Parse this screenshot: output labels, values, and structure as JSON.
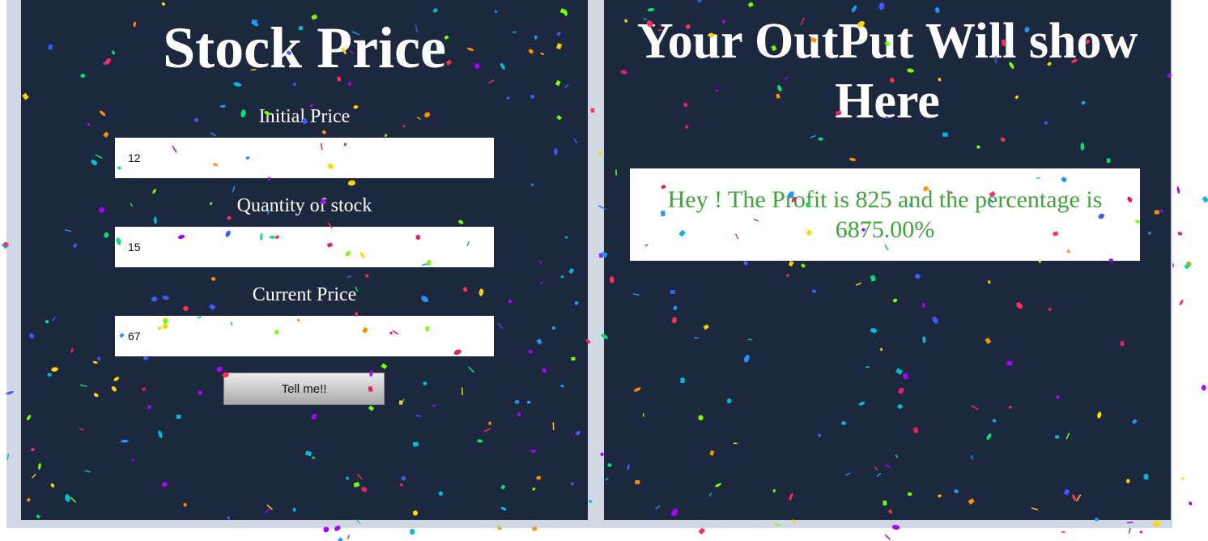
{
  "left_panel": {
    "title": "Stock Price",
    "fields": [
      {
        "label": "Initial Price",
        "value": "12"
      },
      {
        "label": "Quantity of stock",
        "value": "15"
      },
      {
        "label": "Current Price",
        "value": "67"
      }
    ],
    "button_label": "Tell me!!"
  },
  "right_panel": {
    "title": "Your OutPut Will show Here",
    "output_text": "Hey ! The Profit is 825 and the percentage is 6875.00%"
  },
  "colors": {
    "panel_bg": "#1b283e",
    "frame_bg": "#cfd8e3",
    "output_text": "#3fa53a",
    "confetti": [
      "#ff2d55",
      "#ffd600",
      "#00e676",
      "#2196f3",
      "#aa00ff",
      "#ff9100",
      "#00bcd4",
      "#e91e63",
      "#76ff03",
      "#3d5afe"
    ]
  }
}
